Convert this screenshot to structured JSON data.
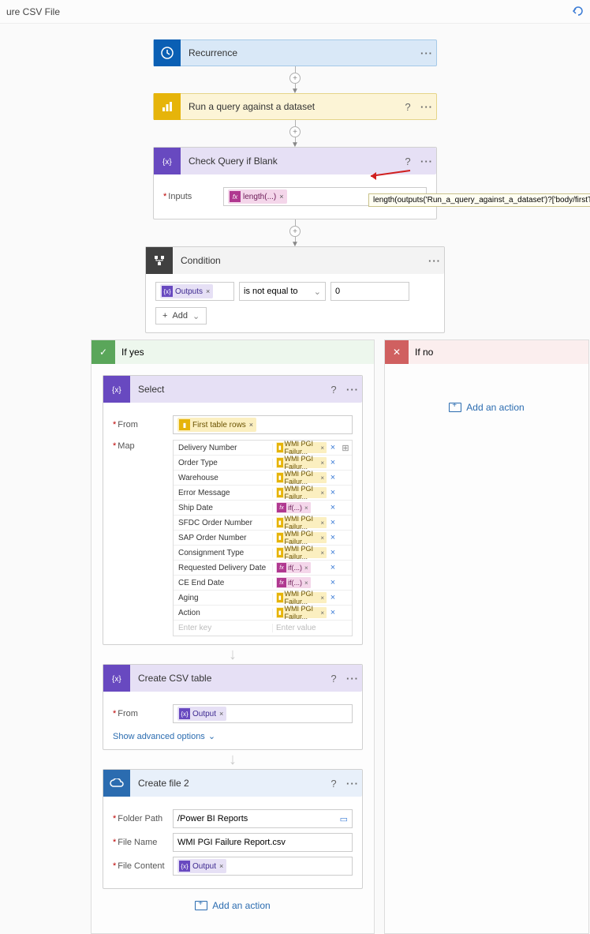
{
  "topbar": {
    "title": "ure CSV File",
    "undo_tooltip": "Undo"
  },
  "steps": {
    "recurrence": "Recurrence",
    "run_query": "Run a query against a dataset",
    "check_blank": "Check Query if Blank",
    "condition": "Condition",
    "select": "Select",
    "csv": "Create CSV table",
    "create_file": "Create file 2"
  },
  "check": {
    "inputs_label": "Inputs",
    "fx_chip": "length(...)",
    "tooltip": "length(outputs('Run_a_query_against_a_dataset')?['body/firstTableRows'])"
  },
  "condition": {
    "left_chip": "Outputs",
    "operator": "is not equal to",
    "right": "0",
    "add": "Add"
  },
  "branch": {
    "yes": "If yes",
    "no": "If no",
    "add_action": "Add an action"
  },
  "select": {
    "from_label": "From",
    "map_label": "Map",
    "from_chip": "First table rows",
    "map": [
      {
        "key": "Delivery Number",
        "type": "y",
        "val": "WMI PGI Failur..."
      },
      {
        "key": "Order Type",
        "type": "y",
        "val": "WMI PGI Failur..."
      },
      {
        "key": "Warehouse",
        "type": "y",
        "val": "WMI PGI Failur..."
      },
      {
        "key": "Error Message",
        "type": "y",
        "val": "WMI PGI Failur..."
      },
      {
        "key": "Ship Date",
        "type": "m",
        "val": "if(...)"
      },
      {
        "key": "SFDC Order Number",
        "type": "y",
        "val": "WMI PGI Failur..."
      },
      {
        "key": "SAP Order Number",
        "type": "y",
        "val": "WMI PGI Failur..."
      },
      {
        "key": "Consignment Type",
        "type": "y",
        "val": "WMI PGI Failur..."
      },
      {
        "key": "Requested Delivery Date",
        "type": "m",
        "val": "if(...)"
      },
      {
        "key": "CE End Date",
        "type": "m",
        "val": "if(...)"
      },
      {
        "key": "Aging",
        "type": "y",
        "val": "WMI PGI Failur..."
      },
      {
        "key": "Action",
        "type": "y",
        "val": "WMI PGI Failur..."
      }
    ],
    "key_ph": "Enter key",
    "val_ph": "Enter value"
  },
  "csv": {
    "from_label": "From",
    "output_chip": "Output",
    "adv": "Show advanced options"
  },
  "file": {
    "path_label": "Folder Path",
    "path": "/Power BI Reports",
    "name_label": "File Name",
    "name": "WMI PGI Failure Report.csv",
    "content_label": "File Content",
    "content_chip": "Output"
  }
}
